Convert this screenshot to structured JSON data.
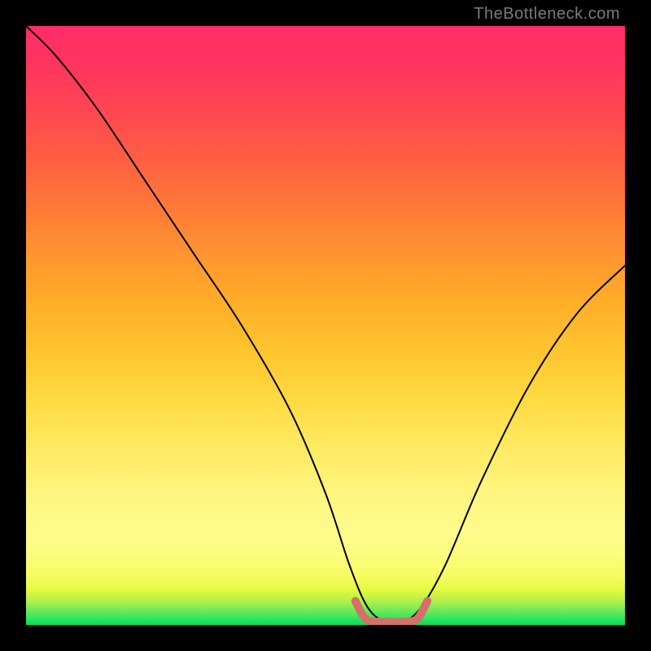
{
  "watermark": "TheBottleneck.com",
  "chart_data": {
    "type": "line",
    "title": "",
    "xlabel": "",
    "ylabel": "",
    "xlim": [
      0,
      100
    ],
    "ylim": [
      0,
      100
    ],
    "series": [
      {
        "name": "bottleneck-curve",
        "color": "#000000",
        "x": [
          0,
          5,
          12,
          20,
          28,
          36,
          44,
          50,
          54,
          57,
          60,
          63,
          66,
          70,
          76,
          84,
          92,
          100
        ],
        "y": [
          100,
          95,
          86,
          74,
          62,
          50,
          36,
          22,
          10,
          3,
          0.5,
          0.5,
          3,
          10,
          24,
          40,
          52,
          60
        ]
      },
      {
        "name": "optimal-segment",
        "color": "#d47068",
        "x": [
          55,
          56,
          57,
          59,
          61,
          63,
          65,
          66,
          67
        ],
        "y": [
          4,
          2,
          0.8,
          0.5,
          0.5,
          0.5,
          0.8,
          2,
          4
        ]
      }
    ],
    "gradient_stops": [
      {
        "pos": 0,
        "color": "#00e060"
      },
      {
        "pos": 50,
        "color": "#ffd940"
      },
      {
        "pos": 100,
        "color": "#ff2c68"
      }
    ]
  }
}
